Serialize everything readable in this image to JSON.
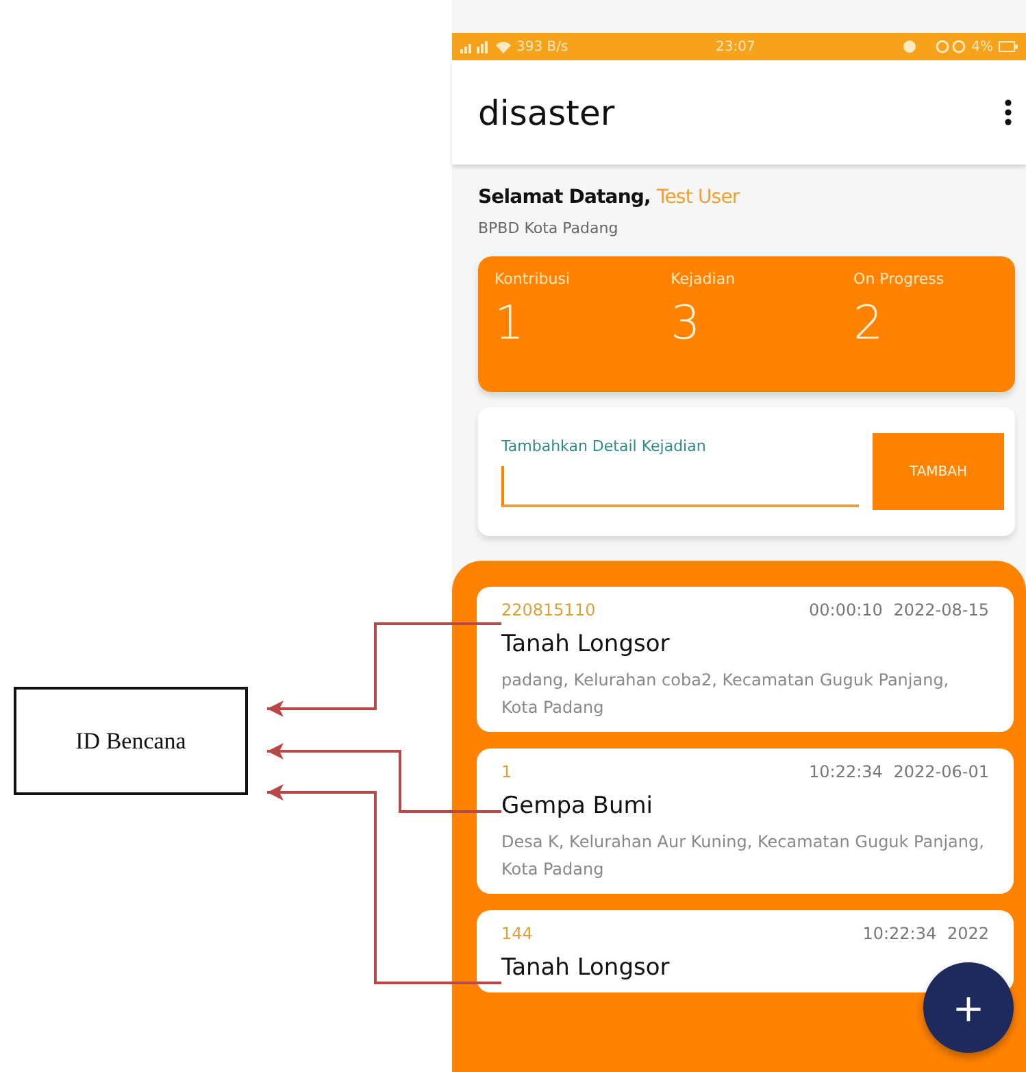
{
  "status_bar": {
    "speed": "393 B/s",
    "time": "23:07",
    "battery": "4%"
  },
  "app_bar": {
    "title": "disaster"
  },
  "greeting": {
    "prefix": "Selamat Datang,",
    "name": "Test User",
    "agency": "BPBD Kota Padang"
  },
  "stats": [
    {
      "label": "Kontribusi",
      "value": "1"
    },
    {
      "label": "Kejadian",
      "value": "3"
    },
    {
      "label": "On Progress",
      "value": "2"
    }
  ],
  "detail_form": {
    "label": "Tambahkan Detail Kejadian",
    "button": "TAMBAH"
  },
  "incidents": [
    {
      "id": "220815110",
      "time": "00:00:10",
      "date": "2022-08-15",
      "title": "Tanah Longsor",
      "address": "padang, Kelurahan coba2, Kecamatan Guguk Panjang, Kota Padang"
    },
    {
      "id": "1",
      "time": "10:22:34",
      "date": "2022-06-01",
      "title": "Gempa Bumi",
      "address": "Desa K, Kelurahan Aur Kuning, Kecamatan Guguk Panjang, Kota Padang"
    },
    {
      "id": "144",
      "time": "10:22:34",
      "date": "2022",
      "title": "Tanah Longsor"
    }
  ],
  "fab": {
    "label": "+"
  },
  "annotation": {
    "label": "ID Bencana"
  }
}
